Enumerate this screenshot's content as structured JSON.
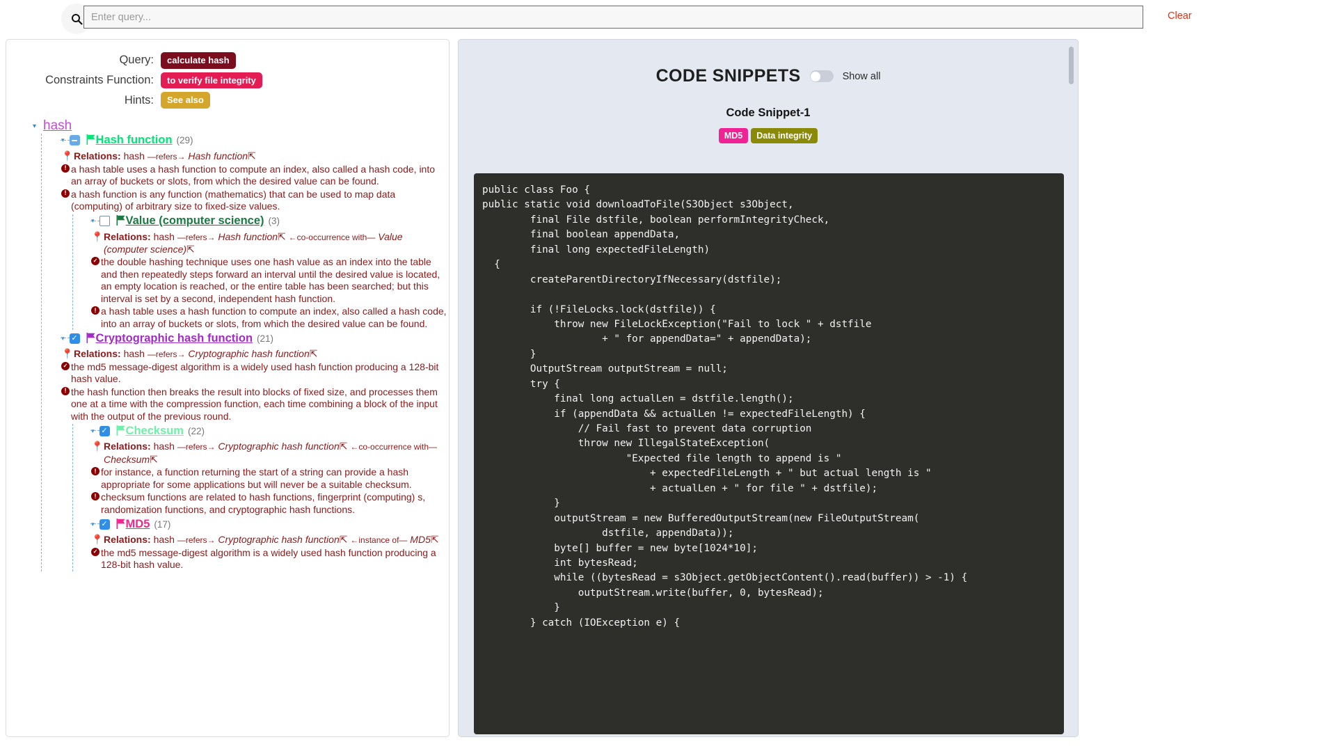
{
  "search": {
    "placeholder": "Enter query...",
    "value": "",
    "clear_label": "Clear",
    "icon": "search-icon"
  },
  "left_panel": {
    "meta": {
      "query_label": "Query:",
      "query_value": "calculate hash",
      "constraints_label": "Constraints Function:",
      "constraints_value": "to verify file integrity",
      "hints_label": "Hints:",
      "hints_value": "See also"
    },
    "root": {
      "label": "hash",
      "caret": "▾"
    },
    "nodes": [
      {
        "label": "Hash function",
        "count": "(29)",
        "checkbox": "indeterminate",
        "color": "#00e676",
        "relations": {
          "title": "Relations:",
          "subject": "hash",
          "pred1": "—refers→",
          "obj1": "Hash function",
          "pred2": "",
          "obj2": ""
        },
        "facts": [
          {
            "icon": "exclamation",
            "text": "a hash table uses a hash function to compute an index, also called a hash code, into an array of buckets or slots, from which the desired value can be found."
          },
          {
            "icon": "exclamation",
            "text": "a hash function is any function (mathematics) that can be used to map data (computing) of arbitrary size to fixed-size values."
          }
        ]
      },
      {
        "label": "Value (computer science)",
        "count": "(3)",
        "checkbox": "empty",
        "color": "#1a7a42",
        "relations": {
          "title": "Relations:",
          "subject": "hash",
          "pred1": "—refers→",
          "obj1": "Hash function",
          "pred2": "←co-occurrence with—",
          "obj2": "Value (computer science)"
        },
        "facts": [
          {
            "icon": "check",
            "text": "the double hashing technique uses one hash value as an index into the table and then repeatedly steps forward an interval until the desired value is located, an empty location is reached, or the entire table has been searched; but this interval is set by a second, independent hash function."
          },
          {
            "icon": "exclamation",
            "text": "a hash table uses a hash function to compute an index, also called a hash code, into an array of buckets or slots, from which the desired value can be found."
          }
        ]
      },
      {
        "label": "Cryptographic hash function",
        "count": "(21)",
        "checkbox": "checked",
        "color": "#a32bc7",
        "relations": {
          "title": "Relations:",
          "subject": "hash",
          "pred1": "—refers→",
          "obj1": "Cryptographic hash function",
          "pred2": "",
          "obj2": ""
        },
        "facts": [
          {
            "icon": "check",
            "text": "the md5 message-digest algorithm is a widely used hash function producing a 128-bit hash value."
          },
          {
            "icon": "exclamation",
            "text": "the hash function then breaks the result into blocks of fixed size, and processes them one at a time with the compression function, each time combining a block of the input with the output of the previous round."
          }
        ]
      },
      {
        "label": "Checksum",
        "count": "(22)",
        "checkbox": "checked",
        "color": "#6ef0a8",
        "relations": {
          "title": "Relations:",
          "subject": "hash",
          "pred1": "—refers→",
          "obj1": "Cryptographic hash function",
          "pred2": "←co-occurrence with—",
          "obj2": "Checksum"
        },
        "facts": [
          {
            "icon": "exclamation",
            "text": "for instance, a function returning the start of a string can provide a hash appropriate for some applications but will never be a suitable checksum."
          },
          {
            "icon": "exclamation",
            "text": "checksum functions are related to hash functions, fingerprint (computing) s, randomization functions, and cryptographic hash functions."
          }
        ]
      },
      {
        "label": "MD5",
        "count": "(17)",
        "checkbox": "checked",
        "color": "#f2268c",
        "relations": {
          "title": "Relations:",
          "subject": "hash",
          "pred1": "—refers→",
          "obj1": "Cryptographic hash function",
          "pred2": "←instance of—",
          "obj2": "MD5"
        },
        "facts": [
          {
            "icon": "check",
            "text": "the md5 message-digest algorithm is a widely used hash function producing a 128-bit hash value."
          }
        ]
      }
    ]
  },
  "right_panel": {
    "title": "CODE SNIPPETS",
    "toggle_label": "Show all",
    "toggle_on": false,
    "snippet_title": "Code Snippet-1",
    "badges": [
      "MD5",
      "Data integrity"
    ],
    "code": "public class Foo {\npublic static void downloadToFile(S3Object s3Object,\n        final File dstfile, boolean performIntegrityCheck,\n        final boolean appendData,\n        final long expectedFileLength)\n  {\n        createParentDirectoryIfNecessary(dstfile);\n\n        if (!FileLocks.lock(dstfile)) {\n            throw new FileLockException(\"Fail to lock \" + dstfile\n                    + \" for appendData=\" + appendData);\n        }\n        OutputStream outputStream = null;\n        try {\n            final long actualLen = dstfile.length();\n            if (appendData && actualLen != expectedFileLength) {\n                // Fail fast to prevent data corruption\n                throw new IllegalStateException(\n                        \"Expected file length to append is \"\n                            + expectedFileLength + \" but actual length is \"\n                            + actualLen + \" for file \" + dstfile);\n            }\n            outputStream = new BufferedOutputStream(new FileOutputStream(\n                    dstfile, appendData));\n            byte[] buffer = new byte[1024*10];\n            int bytesRead;\n            while ((bytesRead = s3Object.getObjectContent().read(buffer)) > -1) {\n                outputStream.write(buffer, 0, bytesRead);\n            }\n        } catch (IOException e) {"
  }
}
